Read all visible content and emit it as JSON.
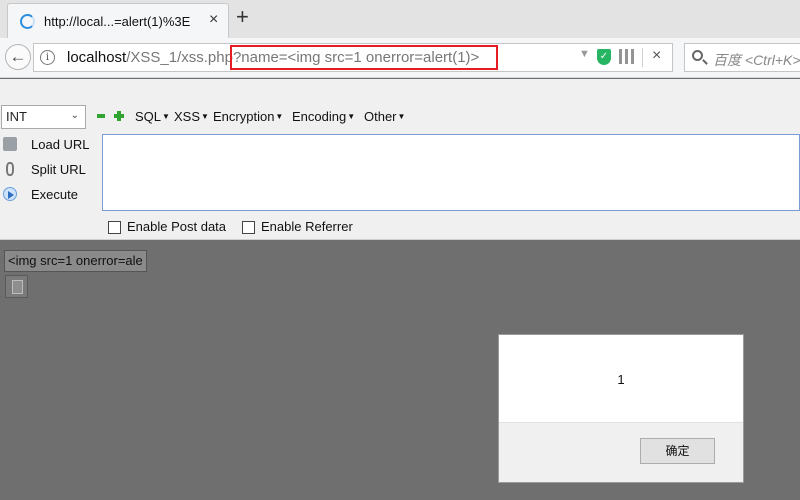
{
  "browser": {
    "tab_title": "http://local...=alert(1)%3E",
    "tab_close": "×",
    "new_tab": "+",
    "url_host": "localhost",
    "url_path": "/XSS_1/xss.php",
    "url_query": "?name=<img src=1 onerror=alert(1)>",
    "search_placeholder": "百度 <Ctrl+K>",
    "url_close": "×",
    "info_glyph": "i"
  },
  "hackbar": {
    "select_value": "INT",
    "menus": [
      "SQL",
      "XSS",
      "Encryption",
      "Encoding",
      "Other"
    ],
    "actions": [
      "Load URL",
      "Split URL",
      "Execute"
    ],
    "textarea_value": "",
    "checkboxes": [
      "Enable Post data",
      "Enable Referrer"
    ]
  },
  "page": {
    "rendered_text": "<img src=1 onerror=ale"
  },
  "alert": {
    "message": "1",
    "ok_label": "确定"
  },
  "icons": {
    "back": "arrow-left",
    "info": "info-icon",
    "shield": "shield-check-icon",
    "qr": "qr-code-icon",
    "search": "search-icon"
  }
}
